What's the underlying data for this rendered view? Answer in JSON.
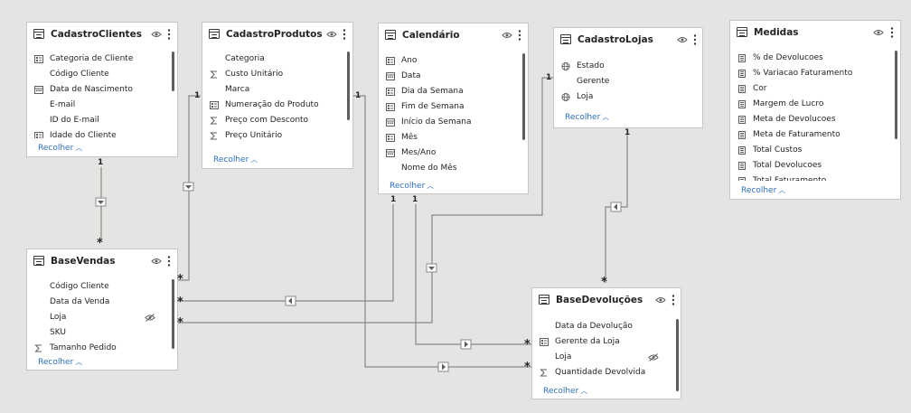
{
  "colors": {
    "canvas": "#e5e4e2",
    "link": "#2e6fbf",
    "line": "#8a8886"
  },
  "collapse_label": "Recolher",
  "tables": {
    "cadastro_clientes": {
      "title": "CadastroClientes",
      "fields": [
        {
          "label": "Categoria de Cliente",
          "icon": "hierarchy-icon"
        },
        {
          "label": "Código Cliente",
          "icon": ""
        },
        {
          "label": "Data de Nascimento",
          "icon": "calendar-icon"
        },
        {
          "label": "E-mail",
          "icon": ""
        },
        {
          "label": "ID do E-mail",
          "icon": ""
        },
        {
          "label": "Idade do Cliente",
          "icon": "hierarchy-icon"
        }
      ]
    },
    "cadastro_produtos": {
      "title": "CadastroProdutos",
      "fields": [
        {
          "label": "Categoria",
          "icon": ""
        },
        {
          "label": "Custo Unitário",
          "icon": "sigma-icon"
        },
        {
          "label": "Marca",
          "icon": ""
        },
        {
          "label": "Numeração do Produto",
          "icon": "hierarchy-icon"
        },
        {
          "label": "Preço com Desconto",
          "icon": "sigma-icon"
        },
        {
          "label": "Preço Unitário",
          "icon": "sigma-icon"
        }
      ]
    },
    "calendario": {
      "title": "Calendário",
      "fields": [
        {
          "label": "Ano",
          "icon": "hierarchy-icon"
        },
        {
          "label": "Data",
          "icon": "calendar-icon"
        },
        {
          "label": "Dia da Semana",
          "icon": "hierarchy-icon"
        },
        {
          "label": "Fim de Semana",
          "icon": "hierarchy-icon"
        },
        {
          "label": "Início da Semana",
          "icon": "calendar-icon"
        },
        {
          "label": "Mês",
          "icon": "hierarchy-icon"
        },
        {
          "label": "Mes/Ano",
          "icon": "calendar-icon"
        },
        {
          "label": "Nome do Mês",
          "icon": ""
        }
      ]
    },
    "cadastro_lojas": {
      "title": "CadastroLojas",
      "fields": [
        {
          "label": "Estado",
          "icon": "globe-icon"
        },
        {
          "label": "Gerente",
          "icon": ""
        },
        {
          "label": "Loja",
          "icon": "globe-icon"
        }
      ]
    },
    "medidas": {
      "title": "Medidas",
      "fields": [
        {
          "label": "% de Devolucoes",
          "icon": "measure-icon"
        },
        {
          "label": "% Variacao Faturamento",
          "icon": "measure-icon"
        },
        {
          "label": "Cor",
          "icon": "measure-icon"
        },
        {
          "label": "Margem de Lucro",
          "icon": "measure-icon"
        },
        {
          "label": "Meta de Devolucoes",
          "icon": "measure-icon"
        },
        {
          "label": "Meta de Faturamento",
          "icon": "measure-icon"
        },
        {
          "label": "Total Custos",
          "icon": "measure-icon"
        },
        {
          "label": "Total Devolucoes",
          "icon": "measure-icon"
        },
        {
          "label": "Total Faturamento",
          "icon": "measure-icon"
        }
      ]
    },
    "base_vendas": {
      "title": "BaseVendas",
      "fields": [
        {
          "label": "Código Cliente",
          "icon": ""
        },
        {
          "label": "Data da Venda",
          "icon": ""
        },
        {
          "label": "Loja",
          "icon": "",
          "hidden": true
        },
        {
          "label": "SKU",
          "icon": ""
        },
        {
          "label": "Tamanho Pedido",
          "icon": "sigma-icon"
        }
      ]
    },
    "base_devolucoes": {
      "title": "BaseDevoluções",
      "fields": [
        {
          "label": "Data da Devolução",
          "icon": ""
        },
        {
          "label": "Gerente da Loja",
          "icon": "hierarchy-icon"
        },
        {
          "label": "Loja",
          "icon": "",
          "hidden": true
        },
        {
          "label": "Quantidade Devolvida",
          "icon": "sigma-icon"
        }
      ]
    }
  },
  "relationship_labels": {
    "one": "1",
    "many": "*"
  }
}
